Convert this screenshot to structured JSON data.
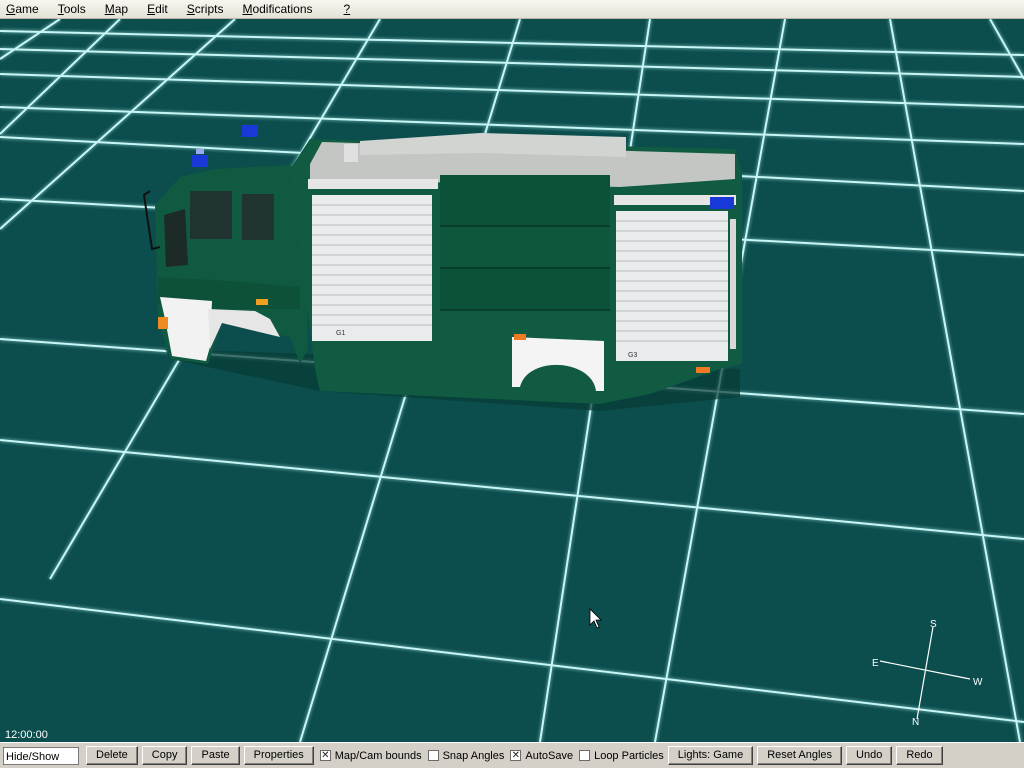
{
  "menu": [
    {
      "label": "Game",
      "accel": "G",
      "rest": "ame"
    },
    {
      "label": "Tools",
      "accel": "T",
      "rest": "ools"
    },
    {
      "label": "Map",
      "accel": "M",
      "rest": "ap"
    },
    {
      "label": "Edit",
      "accel": "E",
      "rest": "dit"
    },
    {
      "label": "Scripts",
      "accel": "S",
      "rest": "cripts"
    },
    {
      "label": "Modifications",
      "accel": "M",
      "rest": "odifications"
    },
    {
      "label": "?",
      "accel": "?",
      "rest": ""
    }
  ],
  "viewport": {
    "time": "12:00:00",
    "compass": {
      "north": "N",
      "south": "S",
      "east": "E",
      "west": "W"
    },
    "grid_color": "#b8f0f0",
    "background_color": "#0c4d4d",
    "vehicle_color": "#0f5a40",
    "vehicle_labels": {
      "left_door": "G1",
      "right_door": "G3"
    }
  },
  "toolbar": {
    "hide_show": "Hide/Show",
    "delete": "Delete",
    "copy": "Copy",
    "paste": "Paste",
    "properties": "Properties",
    "map_cam_bounds": {
      "label": "Map/Cam bounds",
      "checked": true
    },
    "snap_angles": {
      "label": "Snap Angles",
      "checked": false
    },
    "autosave": {
      "label": "AutoSave",
      "checked": true
    },
    "loop_particles": {
      "label": "Loop Particles",
      "checked": false
    },
    "lights": "Lights: Game",
    "reset_angles": "Reset Angles",
    "undo": "Undo",
    "redo": "Redo"
  }
}
